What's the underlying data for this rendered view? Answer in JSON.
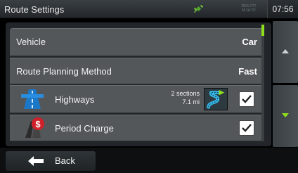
{
  "header": {
    "title": "Route Settings",
    "gps_icon": "satellite-icon",
    "road_text_1": "RDS  FTT",
    "road_text_2": "M 1A TP",
    "time": "07:56"
  },
  "settings": {
    "vehicle": {
      "label": "Vehicle",
      "value": "Car"
    },
    "route_method": {
      "label": "Route Planning Method",
      "value": "Fast"
    },
    "highways": {
      "label": "Highways",
      "sections": "2 sections",
      "distance": "7.1 mi",
      "checked": true,
      "icon": "highway-icon",
      "route_icon": "route-icon"
    },
    "period_charge": {
      "label": "Period Charge",
      "checked": true,
      "icon": "toll-charge-icon"
    }
  },
  "scroll": {
    "up_icon": "chevron-up-icon",
    "down_icon": "chevron-down-icon",
    "position": 0.0
  },
  "footer": {
    "back_label": "Back",
    "back_icon": "arrow-left-icon"
  },
  "colors": {
    "accent_green": "#8fe01c",
    "row_bg": "#54575a",
    "panel_bg": "#22262a",
    "highway_blue": "#1b78c8",
    "toll_red": "#d0202a"
  }
}
